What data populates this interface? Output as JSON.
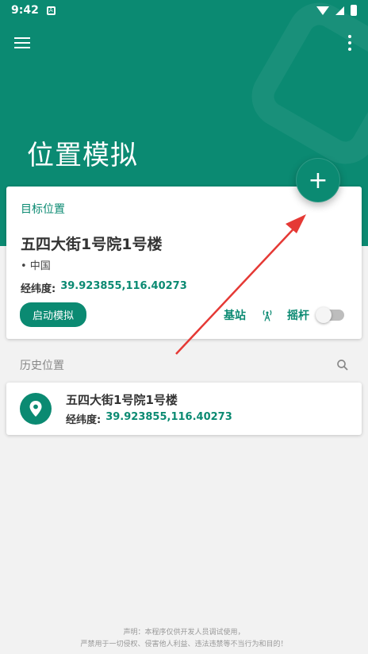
{
  "status_bar": {
    "time": "9:42",
    "notif_glyph": "A"
  },
  "header": {
    "title": "位置模拟",
    "fab_label": "+"
  },
  "target_card": {
    "label": "目标位置",
    "name": "五四大街1号院1号楼",
    "country": "• 中国",
    "coords_key": "经纬度:",
    "coords_value": "39.923855,116.40273",
    "start_button": "启动模拟",
    "station_label": "基站",
    "joystick_label": "摇杆",
    "joystick_on": false
  },
  "history": {
    "title": "历史位置",
    "items": [
      {
        "name": "五四大街1号院1号楼",
        "coords_key": "经纬度:",
        "coords_value": "39.923855,116.40273"
      }
    ]
  },
  "disclaimer": {
    "line1": "声明：本程序仅供开发人员调试使用，",
    "line2": "严禁用于一切侵权、侵害他人利益、违法违禁等不当行为和目的！"
  },
  "colors": {
    "primary": "#0b8a72",
    "arrow": "#e53935"
  },
  "icons": [
    "menu-icon",
    "more-vert-icon",
    "add-icon",
    "antenna-icon",
    "search-icon",
    "location-pin-icon",
    "wifi-icon",
    "signal-icon",
    "battery-icon"
  ]
}
